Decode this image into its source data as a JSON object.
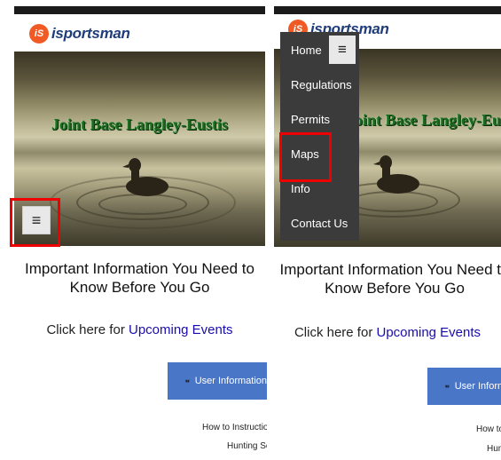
{
  "logo": {
    "badge": "iS",
    "text": "isportsman",
    "icon": "isportsman-logo-icon"
  },
  "hero": {
    "title": "Joint Base Langley-Eustis",
    "image": "duck-on-lake-photo"
  },
  "menu": {
    "toggle_icon": "hamburger-icon",
    "items": [
      "Home",
      "Regulations",
      "Permits",
      "Maps",
      "Info",
      "Contact Us"
    ]
  },
  "main": {
    "heading_line1": "Important Information You Need to",
    "heading_line2": "Know Before You Go",
    "click_prefix": "Click here for",
    "click_link": "Upcoming Events",
    "user_info_button": "User Information",
    "user_info_button_right": "User Information",
    "links": [
      "How to Instructions",
      "Hunting Season"
    ]
  },
  "colors": {
    "accent_blue": "#4a76c8",
    "highlight_red": "#ee0000",
    "link": "#1a0dab",
    "menu_bg": "#3b3b3b"
  }
}
